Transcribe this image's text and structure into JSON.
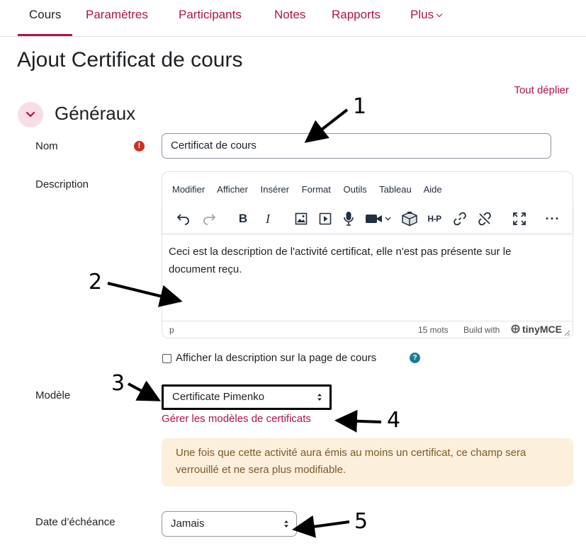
{
  "nav": {
    "tabs": [
      {
        "label": "Cours",
        "active": true
      },
      {
        "label": "Paramètres"
      },
      {
        "label": "Participants"
      },
      {
        "label": "Notes"
      },
      {
        "label": "Rapports"
      },
      {
        "label": "Plus"
      }
    ]
  },
  "page": {
    "title": "Ajout Certificat de cours",
    "expand_all": "Tout déplier"
  },
  "section": {
    "title": "Généraux"
  },
  "form": {
    "name_label": "Nom",
    "name_value": "Certificat de cours",
    "description_label": "Description",
    "editor": {
      "menus": [
        "Modifier",
        "Afficher",
        "Insérer",
        "Format",
        "Outils",
        "Tableau",
        "Aide"
      ],
      "content": "Ceci est la description de l'activité certificat, elle n'est pas présente sur le document reçu.",
      "path": "p",
      "word_count": "15 mots",
      "build_with": "Build with",
      "brand": "tinyMCE",
      "h5p": "H-P"
    },
    "show_description_label": "Afficher la description sur la page de cours",
    "template_label": "Modèle",
    "template_value": "Certificate Pimenko",
    "manage_templates_link": "Gérer les modèles de certificats",
    "notice": "Une fois que cette activité aura émis au moins un certificat, ce champ sera verrouillé et ne sera plus modifiable.",
    "due_date_label": "Date d’échéance",
    "due_date_value": "Jamais"
  },
  "annotations": [
    "1",
    "2",
    "3",
    "4",
    "5"
  ]
}
